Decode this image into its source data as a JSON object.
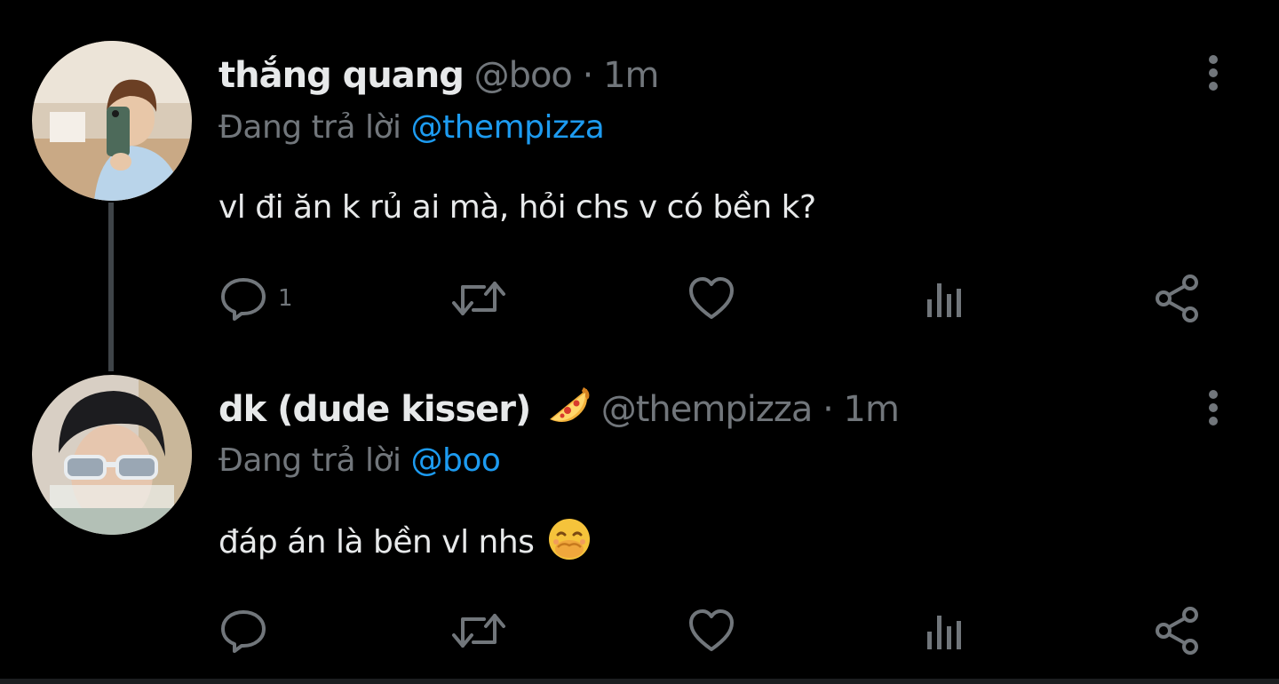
{
  "colors": {
    "background": "#000000",
    "text_primary": "#e7e9ea",
    "text_secondary": "#71767b",
    "link": "#1d9bf0",
    "thread_line": "#3f4448"
  },
  "tweets": [
    {
      "display_name": "thắng quang",
      "handle": "@boo",
      "separator": "·",
      "time": "1m",
      "reply_prefix": "Đang trả lời",
      "reply_to": "@thempizza",
      "text": "vl đi ăn k rủ ai mà, hỏi chs v có bền k?",
      "name_emoji": "",
      "text_emoji": "",
      "reply_count": "1",
      "icons": [
        "reply-icon",
        "retweet-icon",
        "like-icon",
        "views-icon",
        "share-icon",
        "more-icon"
      ]
    },
    {
      "display_name": "dk (dude kisser)",
      "handle": "@thempizza",
      "separator": "·",
      "time": "1m",
      "reply_prefix": "Đang trả lời",
      "reply_to": "@boo",
      "text": "đáp án là bền vl nhs",
      "name_emoji": "pizza-emoji",
      "text_emoji": "face-with-hand-over-mouth-emoji",
      "reply_count": "",
      "icons": [
        "reply-icon",
        "retweet-icon",
        "like-icon",
        "views-icon",
        "share-icon",
        "more-icon"
      ]
    }
  ]
}
